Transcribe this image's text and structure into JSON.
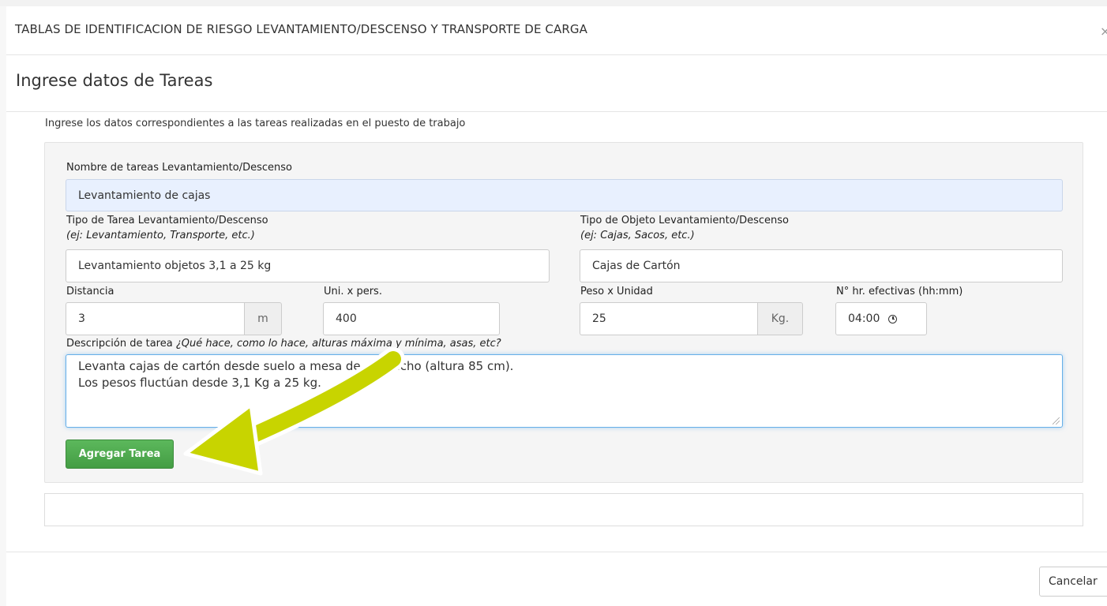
{
  "modal": {
    "title": "TABLAS DE IDENTIFICACION DE RIESGO LEVANTAMIENTO/DESCENSO Y TRANSPORTE DE CARGA",
    "close_glyph": "×"
  },
  "section": {
    "title": "Ingrese datos de Tareas",
    "instructions": "Ingrese los datos correspondientes a las tareas realizadas en el puesto de trabajo"
  },
  "form": {
    "nombre_label": "Nombre de tareas Levantamiento/Descenso",
    "nombre_value": "Levantamiento de cajas",
    "tipo_tarea_label": "Tipo de Tarea Levantamiento/Descenso",
    "tipo_tarea_hint": "(ej: Levantamiento, Transporte, etc.)",
    "tipo_tarea_value": "Levantamiento objetos  3,1 a 25 kg",
    "tipo_objeto_label": "Tipo de Objeto Levantamiento/Descenso",
    "tipo_objeto_hint": "(ej: Cajas, Sacos, etc.)",
    "tipo_objeto_value": "Cajas de Cartón",
    "distancia_label": "Distancia",
    "distancia_value": "3",
    "distancia_unit": "m",
    "uni_pers_label": "Uni. x pers.",
    "uni_pers_value": "400",
    "peso_label": "Peso x Unidad",
    "peso_value": "25",
    "peso_unit": "Kg.",
    "horas_label": "N° hr. efectivas (hh:mm)",
    "horas_value": "04:00",
    "descripcion_label": "Descripción de tarea",
    "descripcion_hint": "¿Qué hace, como lo hace, alturas máxima y mínima, asas, etc?",
    "descripcion_lines": [
      "Levanta  cajas de cartón desde suelo a  mesa de despacho (altura 85 cm).",
      "Los pesos fluctúan desde 3,1 Kg a 25 kg."
    ],
    "add_button": "Agregar Tarea"
  },
  "footer": {
    "cancel_button": "Cancelar"
  },
  "colors": {
    "primary_green": "#5cb85c",
    "annotation_arrow": "#c8d400",
    "focus_blue": "#66afe9",
    "highlight_field": "#e8f0fe"
  }
}
